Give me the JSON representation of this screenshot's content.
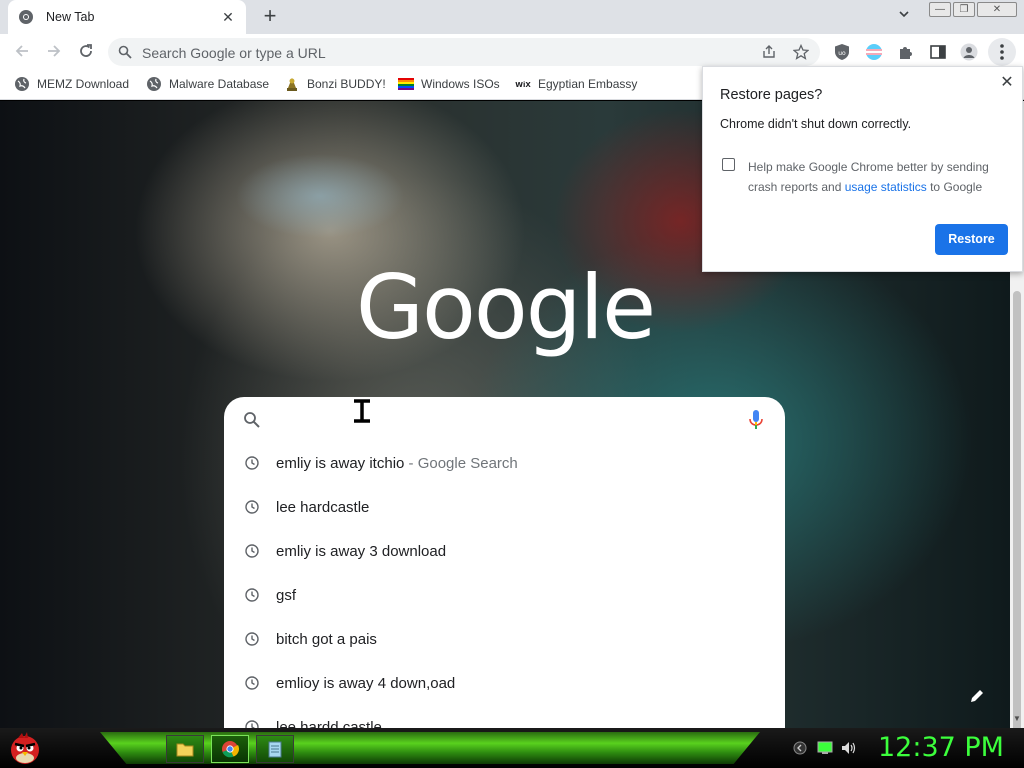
{
  "tab": {
    "title": "New Tab"
  },
  "window_controls": {
    "minimize": "—",
    "restore": "❐",
    "close": "✕"
  },
  "omnibox": {
    "placeholder": "Search Google or type a URL"
  },
  "bookmarks": [
    {
      "label": "MEMZ Download",
      "icon": "globe-icon"
    },
    {
      "label": "Malware Database",
      "icon": "globe-icon"
    },
    {
      "label": "Bonzi BUDDY!",
      "icon": "bonzi-icon"
    },
    {
      "label": "Windows ISOs",
      "icon": "rainbow-flag-icon"
    },
    {
      "label": "Egyptian Embassy",
      "icon": "wix-icon"
    }
  ],
  "newtab": {
    "logo": "Google"
  },
  "suggestions": [
    {
      "text": "emliy is away itchio",
      "suffix": " - Google Search"
    },
    {
      "text": "lee hardcastle",
      "suffix": ""
    },
    {
      "text": "emliy is away 3 download",
      "suffix": ""
    },
    {
      "text": "gsf",
      "suffix": ""
    },
    {
      "text": "bitch got a pais",
      "suffix": ""
    },
    {
      "text": "emlioy is away 4 down,oad",
      "suffix": ""
    },
    {
      "text": "lee hardd castle",
      "suffix": ""
    }
  ],
  "restore_popup": {
    "title": "Restore pages?",
    "message": "Chrome didn't shut down correctly.",
    "checkbox_text_before": "Help make Google Chrome better by sending crash reports and ",
    "checkbox_link": "usage statistics",
    "checkbox_text_after": " to Google",
    "restore_label": "Restore"
  },
  "taskbar": {
    "clock": "12:37 PM"
  },
  "colors": {
    "accent": "#1a73e8",
    "clock": "#3cff3c",
    "taskbar_green": "#59d11e"
  }
}
